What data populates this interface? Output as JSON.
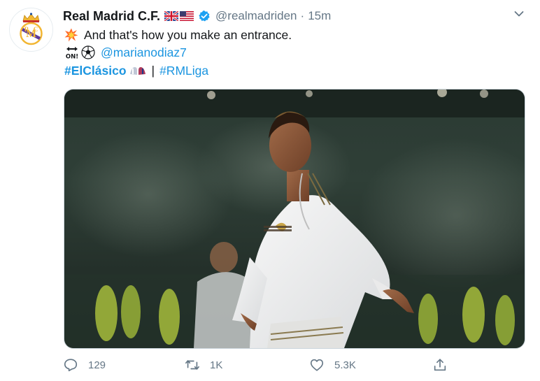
{
  "tweet": {
    "name": "Real Madrid C.F.",
    "handle": "@realmadriden",
    "separator": "·",
    "time": "15m",
    "text_line1": "And that's how you make an entrance.",
    "mention": "@marianodiaz7",
    "hashtag1": "#ElClásico",
    "divider": "|",
    "hashtag2": "#RMLiga"
  },
  "actions": {
    "reply_count": "129",
    "retweet_count": "1K",
    "like_count": "5.3K"
  },
  "colors": {
    "link": "#1b95e0",
    "muted": "#657786",
    "verified": "#1da1f2"
  },
  "icons": [
    "real-madrid-crest-icon",
    "uk-flag-icon",
    "us-flag-icon",
    "verified-badge-icon",
    "chevron-down-icon",
    "explosion-emoji-icon",
    "on-arrow-emoji-icon",
    "soccer-ball-emoji-icon",
    "elclasico-emoji-icon",
    "reply-icon",
    "retweet-icon",
    "like-icon",
    "share-icon"
  ]
}
